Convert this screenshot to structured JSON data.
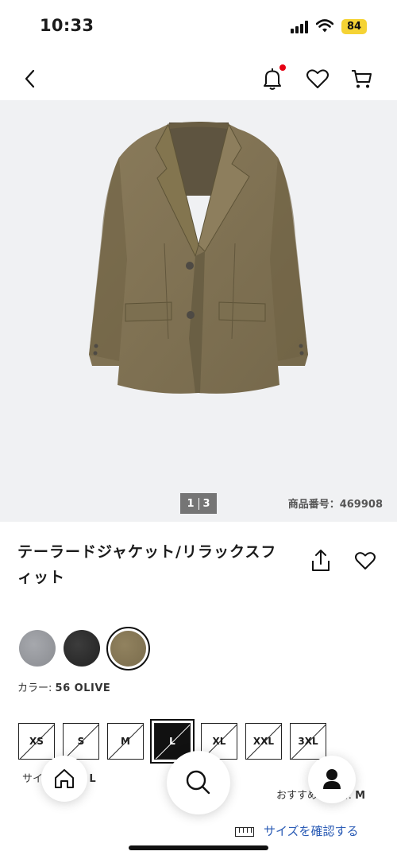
{
  "status_bar": {
    "time": "10:33",
    "battery_level": "84",
    "icons": [
      "signal-icon",
      "wifi-icon",
      "battery-icon"
    ]
  },
  "nav": {
    "icons": [
      "back-chevron-icon",
      "notification-bell-icon",
      "favorite-heart-icon",
      "cart-icon"
    ],
    "notification_dot_color": "#e60012"
  },
  "gallery": {
    "current_page": "1",
    "total_pages": "3",
    "product_number": "商品番号：469908"
  },
  "product": {
    "title": "テーラードジャケット/リラックスフィット"
  },
  "colors": {
    "label": "カラー:",
    "selected": "56 OLIVE",
    "swatches": [
      {
        "name": "gray",
        "hex": "#9a9ca1"
      },
      {
        "name": "black",
        "hex": "#2b2b2b"
      },
      {
        "name": "olive",
        "hex": "#877858",
        "selected": true
      }
    ]
  },
  "sizes": {
    "options": [
      "XS",
      "S",
      "M",
      "L",
      "XL",
      "XXL",
      "3XL"
    ],
    "selected": "L",
    "label": "サイズ:",
    "selected_label": "MEN L",
    "recommended_label": "おすすめサイズ:",
    "recommended_value": "M",
    "check_link": "サイズを確認する"
  },
  "bottom_bar": {
    "icons": [
      "home-icon",
      "search-icon",
      "account-icon"
    ]
  }
}
